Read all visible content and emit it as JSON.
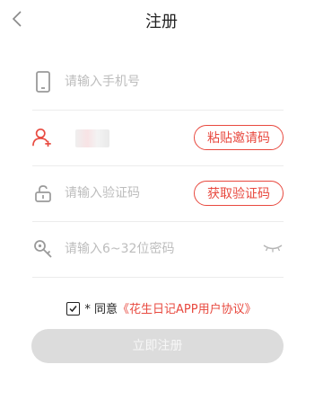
{
  "header": {
    "title": "注册",
    "back_icon": "chevron-left-icon"
  },
  "form": {
    "phone": {
      "icon": "phone-icon",
      "placeholder": "请输入手机号",
      "value": ""
    },
    "invite": {
      "icon": "add-user-icon",
      "paste_label": "粘贴邀请码"
    },
    "code": {
      "icon": "lock-icon",
      "placeholder": "请输入验证码",
      "value": "",
      "get_code_label": "获取验证码"
    },
    "password": {
      "icon": "key-icon",
      "placeholder": "请输入6~32位密码",
      "value": "",
      "eye_icon": "eye-closed-icon"
    }
  },
  "agreement": {
    "checked": true,
    "prefix": "* 同意",
    "link_text": "《花生日记APP用户协议》"
  },
  "submit_label": "立即注册",
  "colors": {
    "accent": "#e8493f",
    "icon_gray": "#9a9a9a",
    "button_disabled": "#dcdcdc",
    "divider": "#ececec"
  }
}
